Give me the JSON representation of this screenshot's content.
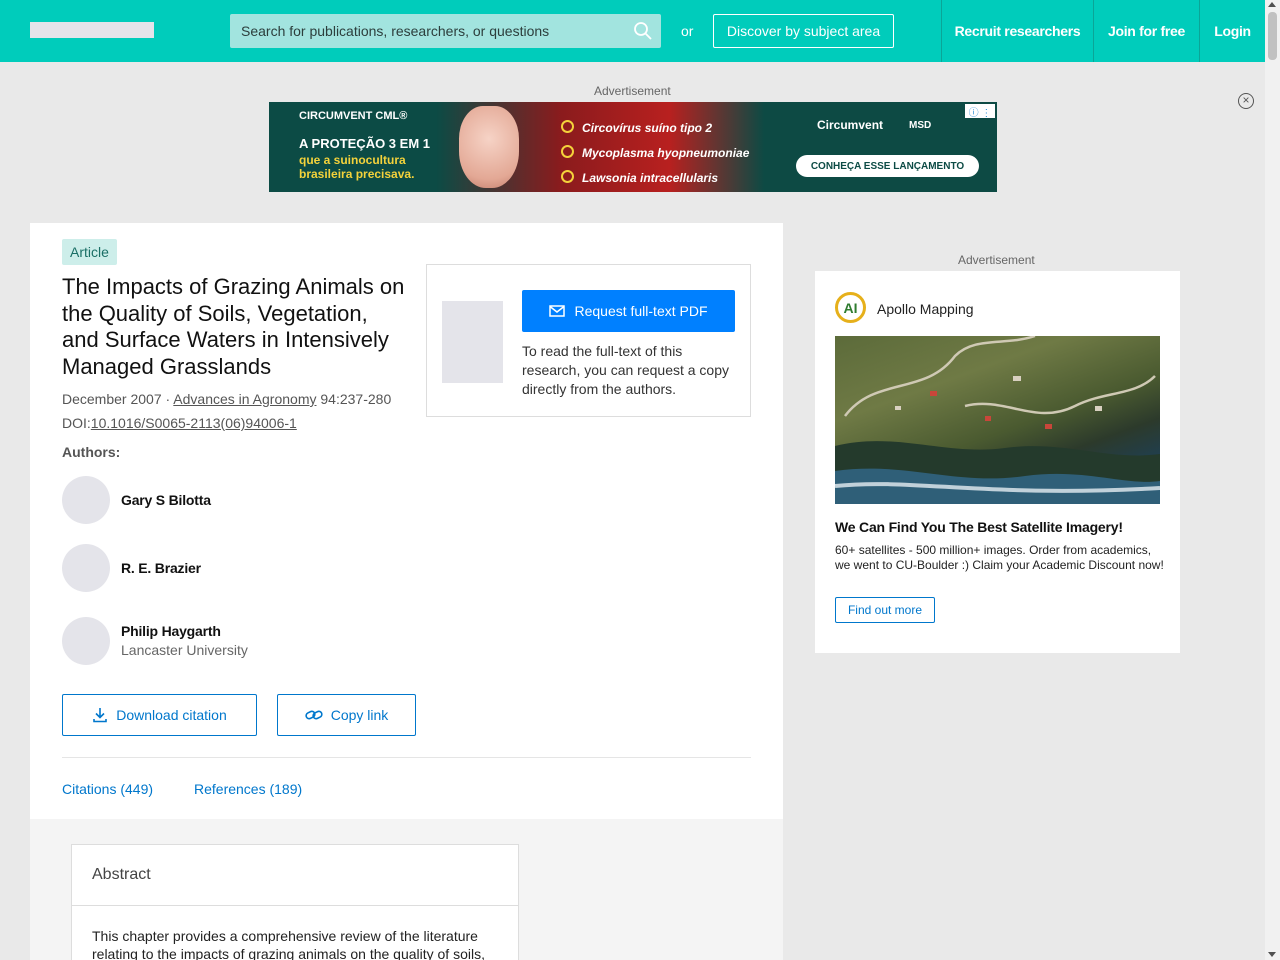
{
  "header": {
    "search_placeholder": "Search for publications, researchers, or questions",
    "or_text": "or",
    "discover_label": "Discover by subject area",
    "nav": [
      "Recruit researchers",
      "Join for free",
      "Login"
    ]
  },
  "ads": {
    "label": "Advertisement",
    "banner": {
      "brand_small": "CIRCUMVENT CML®",
      "headline": "A PROTEÇÃO 3 EM 1",
      "subline": "que a suinocultura brasileira precisava.",
      "bullets": [
        "Circovírus suíno tipo 2",
        "Mycoplasma hyopneumoniae",
        "Lawsonia intracellularis"
      ],
      "brand": "Circumvent",
      "brand2": "MSD",
      "cta": "CONHEÇA ESSE LANÇAMENTO"
    },
    "side": {
      "brand": "Apollo Mapping",
      "logo_text": "AI",
      "headline": "We Can Find You The Best Satellite Imagery!",
      "description": "60+ satellites - 500 million+ images. Order from academics, we went to CU-Boulder :) Claim your Academic Discount now!",
      "cta": "Find out more"
    }
  },
  "article": {
    "badge": "Article",
    "title": "The Impacts of Grazing Animals on the Quality of Soils, Vegetation, and Surface Waters in Intensively Managed Grasslands",
    "date": "December 2007",
    "separator": " · ",
    "journal": "Advances in Agronomy",
    "pages": " 94:237-280",
    "doi_prefix": "DOI:",
    "doi": "10.1016/S0065-2113(06)94006-1",
    "authors_label": "Authors:",
    "authors": [
      {
        "name": "Gary S Bilotta",
        "affiliation": ""
      },
      {
        "name": "R. E. Brazier",
        "affiliation": ""
      },
      {
        "name": "Philip Haygarth",
        "affiliation": "Lancaster University"
      }
    ],
    "download_citation": "Download citation",
    "copy_link": "Copy link",
    "tabs": [
      "Citations (449)",
      "References (189)"
    ],
    "request_pdf": "Request full-text PDF",
    "request_text": "To read the full-text of this research, you can request a copy directly from the authors."
  },
  "abstract": {
    "title": "Abstract",
    "text": "This chapter provides a comprehensive review of the literature relating to the impacts of grazing animals on the quality of soils,"
  },
  "colors": {
    "brand": "#00ccbb",
    "link": "#0077cc",
    "primary_button": "#0080ff"
  }
}
